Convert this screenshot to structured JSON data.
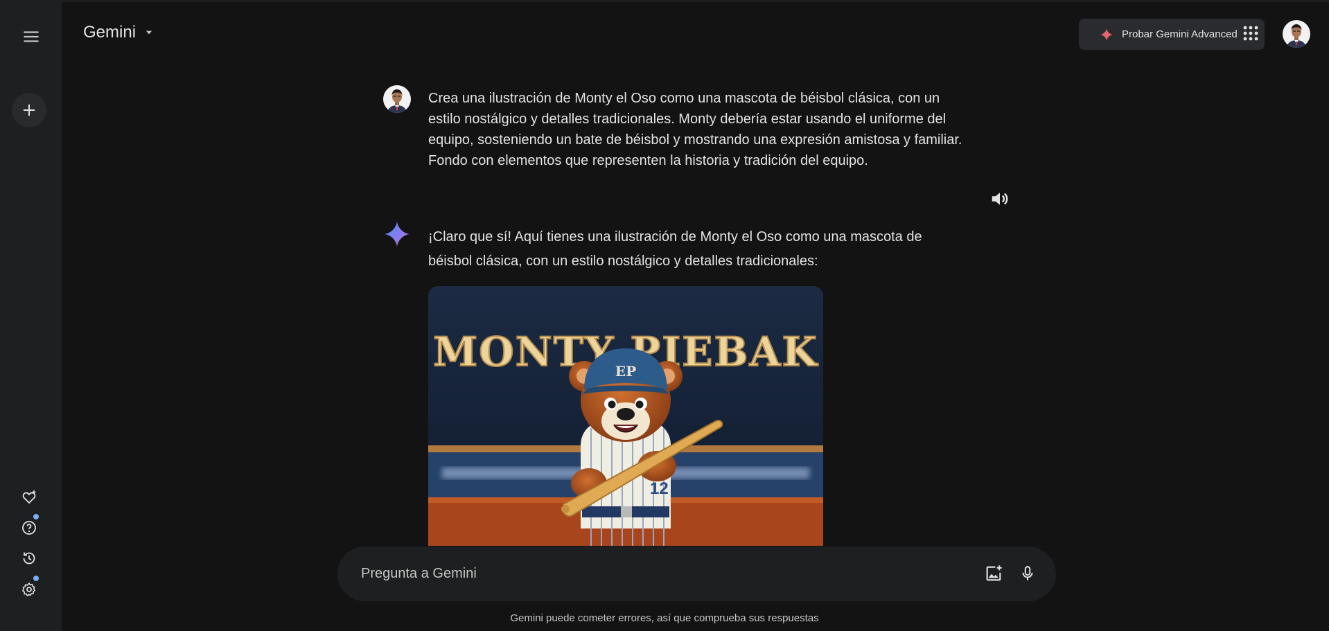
{
  "header": {
    "title": "Gemini",
    "upgrade_label": "Probar Gemini Advanced"
  },
  "sidebar": {
    "icons": [
      "menu-icon",
      "plus-icon",
      "gem-icon",
      "help-icon",
      "history-icon",
      "settings-icon"
    ]
  },
  "conversation": {
    "user_prompt": "Crea una ilustración de Monty el Oso como una mascota de béisbol clásica, con un estilo nostálgico y detalles tradicionales. Monty debería estar usando el uniforme del equipo, sosteniendo un bate de béisbol y mostrando una expresión amistosa y familiar. Fondo con elementos que representen la historia y tradición del equipo.",
    "response": "¡Claro que sí! Aquí tienes una ilustración de Monty el Oso como una mascota de béisbol clásica, con un estilo nostálgico y detalles tradicionales:",
    "image_banner_text": "MONTY PIEBAK",
    "image_cap_logo": "EP",
    "image_jersey_number": "12"
  },
  "input": {
    "placeholder": "Pregunta a Gemini"
  },
  "footer": {
    "disclaimer": "Gemini puede cometer errores, así que comprueba sus respuestas"
  },
  "colors": {
    "background": "#131314",
    "sidebar": "#1e1f20",
    "accent_blue": "#7cacf8",
    "upgrade_star": "#e8626f"
  }
}
